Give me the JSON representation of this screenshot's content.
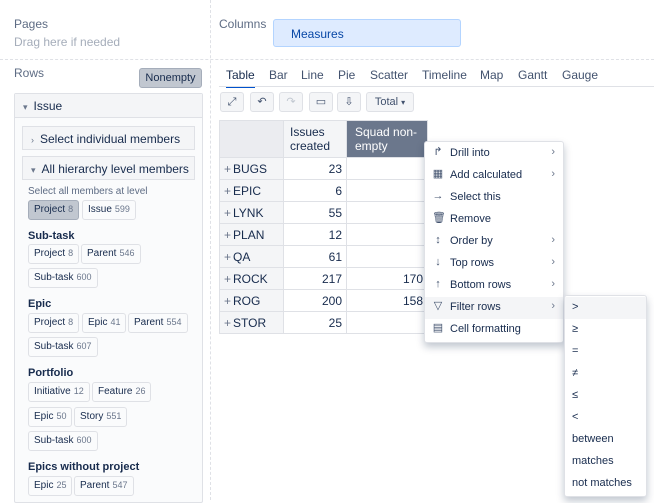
{
  "pages": {
    "label": "Pages",
    "hint": "Drag here if needed"
  },
  "columns": {
    "label": "Columns",
    "measures": "Measures"
  },
  "rows": {
    "label": "Rows",
    "nonempty": "Nonempty",
    "issue_title": "Issue",
    "select_individual": "Select individual members",
    "all_levels": "All hierarchy level members",
    "select_all_label": "Select all members at level",
    "level_chips": [
      {
        "name": "Project",
        "count": "8"
      },
      {
        "name": "Issue",
        "count": "599"
      }
    ],
    "groups": [
      {
        "title": "Sub-task",
        "chips": [
          {
            "name": "Project",
            "count": "8"
          },
          {
            "name": "Parent",
            "count": "546"
          },
          {
            "name": "Sub-task",
            "count": "600"
          }
        ]
      },
      {
        "title": "Epic",
        "chips": [
          {
            "name": "Project",
            "count": "8"
          },
          {
            "name": "Epic",
            "count": "41"
          },
          {
            "name": "Parent",
            "count": "554"
          },
          {
            "name": "Sub-task",
            "count": "607"
          }
        ]
      },
      {
        "title": "Portfolio",
        "chips": [
          {
            "name": "Initiative",
            "count": "12"
          },
          {
            "name": "Feature",
            "count": "26"
          },
          {
            "name": "Epic",
            "count": "50"
          },
          {
            "name": "Story",
            "count": "551"
          },
          {
            "name": "Sub-task",
            "count": "600"
          }
        ]
      },
      {
        "title": "Epics without project",
        "chips": [
          {
            "name": "Epic",
            "count": "25"
          },
          {
            "name": "Parent",
            "count": "547"
          }
        ]
      }
    ]
  },
  "tabs": [
    "Table",
    "Bar",
    "Line",
    "Pie",
    "Scatter",
    "Timeline",
    "Map",
    "Gantt",
    "Gauge"
  ],
  "toolbar": {
    "total": "Total"
  },
  "table": {
    "col1": "Issues created",
    "col2": "Squad non-empty",
    "rows": [
      {
        "name": "BUGS",
        "v1": "23",
        "v2": ""
      },
      {
        "name": "EPIC",
        "v1": "6",
        "v2": ""
      },
      {
        "name": "LYNK",
        "v1": "55",
        "v2": ""
      },
      {
        "name": "PLAN",
        "v1": "12",
        "v2": ""
      },
      {
        "name": "QA",
        "v1": "61",
        "v2": ""
      },
      {
        "name": "ROCK",
        "v1": "217",
        "v2": "170"
      },
      {
        "name": "ROG",
        "v1": "200",
        "v2": "158"
      },
      {
        "name": "STOR",
        "v1": "25",
        "v2": ""
      }
    ]
  },
  "context_menu": {
    "items": [
      {
        "label": "Drill into",
        "icon": "drill-icon",
        "submenu": true
      },
      {
        "label": "Add calculated",
        "icon": "calculator-icon",
        "submenu": true
      },
      {
        "label": "Select this",
        "icon": "arrow-right-icon",
        "submenu": false
      },
      {
        "label": "Remove",
        "icon": "trash-icon",
        "submenu": false
      },
      {
        "label": "Order by",
        "icon": "sort-icon",
        "submenu": true
      },
      {
        "label": "Top rows",
        "icon": "arrow-down-icon",
        "submenu": true
      },
      {
        "label": "Bottom rows",
        "icon": "arrow-up-icon",
        "submenu": true
      },
      {
        "label": "Filter rows",
        "icon": "filter-icon",
        "submenu": true
      },
      {
        "label": "Cell formatting",
        "icon": "table-icon",
        "submenu": false
      }
    ],
    "filter_submenu": [
      ">",
      "≥",
      "=",
      "≠",
      "≤",
      "<",
      "between",
      "matches",
      "not matches"
    ]
  },
  "colors": {
    "accent": "#0052cc",
    "measures_bg": "#deebff",
    "selected_header": "#6b778c"
  }
}
